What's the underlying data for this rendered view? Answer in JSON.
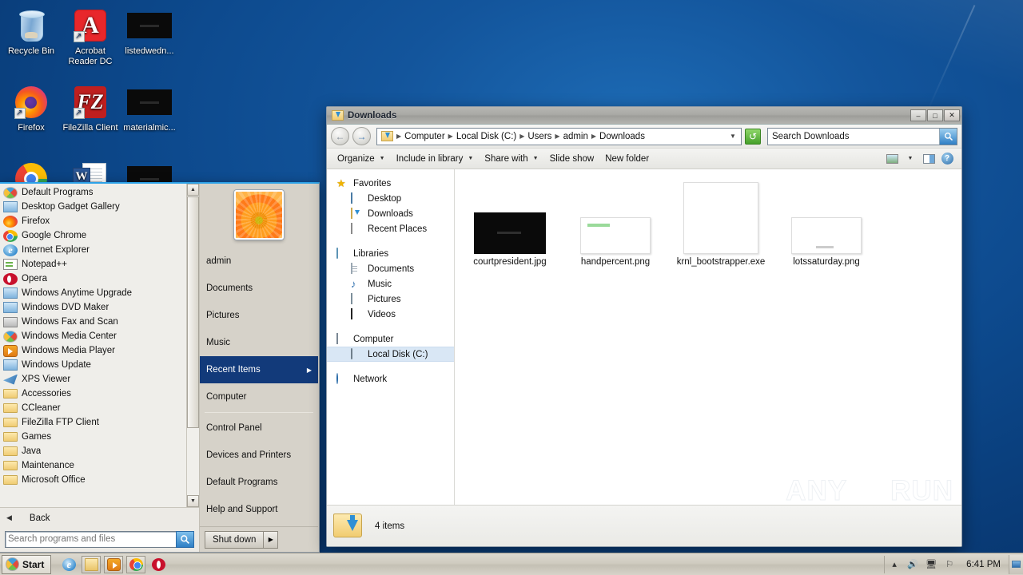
{
  "desktop": {
    "icons": [
      {
        "label": "Recycle Bin",
        "icon": "recycle-bin-icon"
      },
      {
        "label": "Acrobat Reader DC",
        "icon": "acrobat-reader-icon"
      },
      {
        "label": "listedwedn...",
        "icon": "image-file-icon"
      },
      {
        "label": "Firefox",
        "icon": "firefox-icon"
      },
      {
        "label": "FileZilla Client",
        "icon": "filezilla-icon"
      },
      {
        "label": "materialmic...",
        "icon": "image-file-icon"
      },
      {
        "label": "",
        "icon": "chrome-icon"
      },
      {
        "label": "",
        "icon": "word-document-icon"
      },
      {
        "label": "",
        "icon": "image-file-icon"
      }
    ]
  },
  "start_menu": {
    "programs": [
      {
        "label": "Default Programs",
        "icon": "windows-orb-icon"
      },
      {
        "label": "Desktop Gadget Gallery",
        "icon": "gadget-gallery-icon"
      },
      {
        "label": "Firefox",
        "icon": "firefox-icon"
      },
      {
        "label": "Google Chrome",
        "icon": "chrome-icon"
      },
      {
        "label": "Internet Explorer",
        "icon": "internet-explorer-icon"
      },
      {
        "label": "Notepad++",
        "icon": "notepadpp-icon"
      },
      {
        "label": "Opera",
        "icon": "opera-icon"
      },
      {
        "label": "Windows Anytime Upgrade",
        "icon": "windows-anytime-upgrade-icon"
      },
      {
        "label": "Windows DVD Maker",
        "icon": "dvd-maker-icon"
      },
      {
        "label": "Windows Fax and Scan",
        "icon": "fax-scan-icon"
      },
      {
        "label": "Windows Media Center",
        "icon": "windows-orb-icon"
      },
      {
        "label": "Windows Media Player",
        "icon": "media-player-icon"
      },
      {
        "label": "Windows Update",
        "icon": "windows-update-icon"
      },
      {
        "label": "XPS Viewer",
        "icon": "xps-viewer-icon"
      },
      {
        "label": "Accessories",
        "icon": "folder-icon"
      },
      {
        "label": "CCleaner",
        "icon": "folder-icon"
      },
      {
        "label": "FileZilla FTP Client",
        "icon": "folder-icon"
      },
      {
        "label": "Games",
        "icon": "folder-icon"
      },
      {
        "label": "Java",
        "icon": "folder-icon"
      },
      {
        "label": "Maintenance",
        "icon": "folder-icon"
      },
      {
        "label": "Microsoft Office",
        "icon": "folder-icon"
      }
    ],
    "back_label": "Back",
    "search_placeholder": "Search programs and files",
    "user_name": "admin",
    "right_items": [
      {
        "label": "Documents",
        "selected": false,
        "submenu": false
      },
      {
        "label": "Pictures",
        "selected": false,
        "submenu": false
      },
      {
        "label": "Music",
        "selected": false,
        "submenu": false
      },
      {
        "label": "Recent Items",
        "selected": true,
        "submenu": true
      },
      {
        "label": "Computer",
        "selected": false,
        "submenu": false
      },
      {
        "label": "Control Panel",
        "selected": false,
        "submenu": false
      },
      {
        "label": "Devices and Printers",
        "selected": false,
        "submenu": false
      },
      {
        "label": "Default Programs",
        "selected": false,
        "submenu": false
      },
      {
        "label": "Help and Support",
        "selected": false,
        "submenu": false
      }
    ],
    "shutdown_label": "Shut down"
  },
  "explorer": {
    "title": "Downloads",
    "window_buttons": {
      "minimize": "–",
      "maximize": "□",
      "close": "✕"
    },
    "breadcrumbs": [
      "Computer",
      "Local Disk (C:)",
      "Users",
      "admin",
      "Downloads"
    ],
    "search_placeholder": "Search Downloads",
    "toolbar": [
      {
        "label": "Organize",
        "caret": true
      },
      {
        "label": "Include in library",
        "caret": true
      },
      {
        "label": "Share with",
        "caret": true
      },
      {
        "label": "Slide show",
        "caret": false
      },
      {
        "label": "New folder",
        "caret": false
      }
    ],
    "nav_pane": [
      {
        "label": "Favorites",
        "icon": "star-icon",
        "level": 0
      },
      {
        "label": "Desktop",
        "icon": "desktop-icon",
        "level": 1
      },
      {
        "label": "Downloads",
        "icon": "downloads-folder-icon",
        "level": 1
      },
      {
        "label": "Recent Places",
        "icon": "recent-places-icon",
        "level": 1
      },
      {
        "label": "Libraries",
        "icon": "libraries-icon",
        "level": 0
      },
      {
        "label": "Documents",
        "icon": "documents-icon",
        "level": 1
      },
      {
        "label": "Music",
        "icon": "music-icon",
        "level": 1
      },
      {
        "label": "Pictures",
        "icon": "pictures-icon",
        "level": 1
      },
      {
        "label": "Videos",
        "icon": "videos-icon",
        "level": 1
      },
      {
        "label": "Computer",
        "icon": "computer-icon",
        "level": 0
      },
      {
        "label": "Local Disk (C:)",
        "icon": "hard-disk-icon",
        "level": 1,
        "selected": true
      },
      {
        "label": "Network",
        "icon": "network-icon",
        "level": 0
      }
    ],
    "files": [
      {
        "name": "courtpresident.jpg",
        "thumb": "black-image"
      },
      {
        "name": "handpercent.png",
        "thumb": "white-image-green"
      },
      {
        "name": "krnl_bootstrapper.exe",
        "thumb": "tall-white"
      },
      {
        "name": "lotssaturday.png",
        "thumb": "white-image-gray"
      }
    ],
    "status_text": "4 items",
    "watermark": {
      "left": "ANY",
      "right": "RUN"
    }
  },
  "taskbar": {
    "start_label": "Start",
    "quick_launch": [
      {
        "name": "internet-explorer-icon"
      },
      {
        "name": "windows-explorer-icon"
      },
      {
        "name": "media-player-icon"
      },
      {
        "name": "chrome-icon"
      },
      {
        "name": "opera-icon"
      }
    ],
    "tray": [
      "show-hidden-icons",
      "volume-icon",
      "network-icon",
      "flag-action-center-icon"
    ],
    "clock": "6:41 PM"
  },
  "colors": {
    "desktop_blue": "#0d4a8e",
    "selection_blue": "#123a7a",
    "taskbar": "#cfcbc0",
    "accent_green": "#46a02a"
  }
}
